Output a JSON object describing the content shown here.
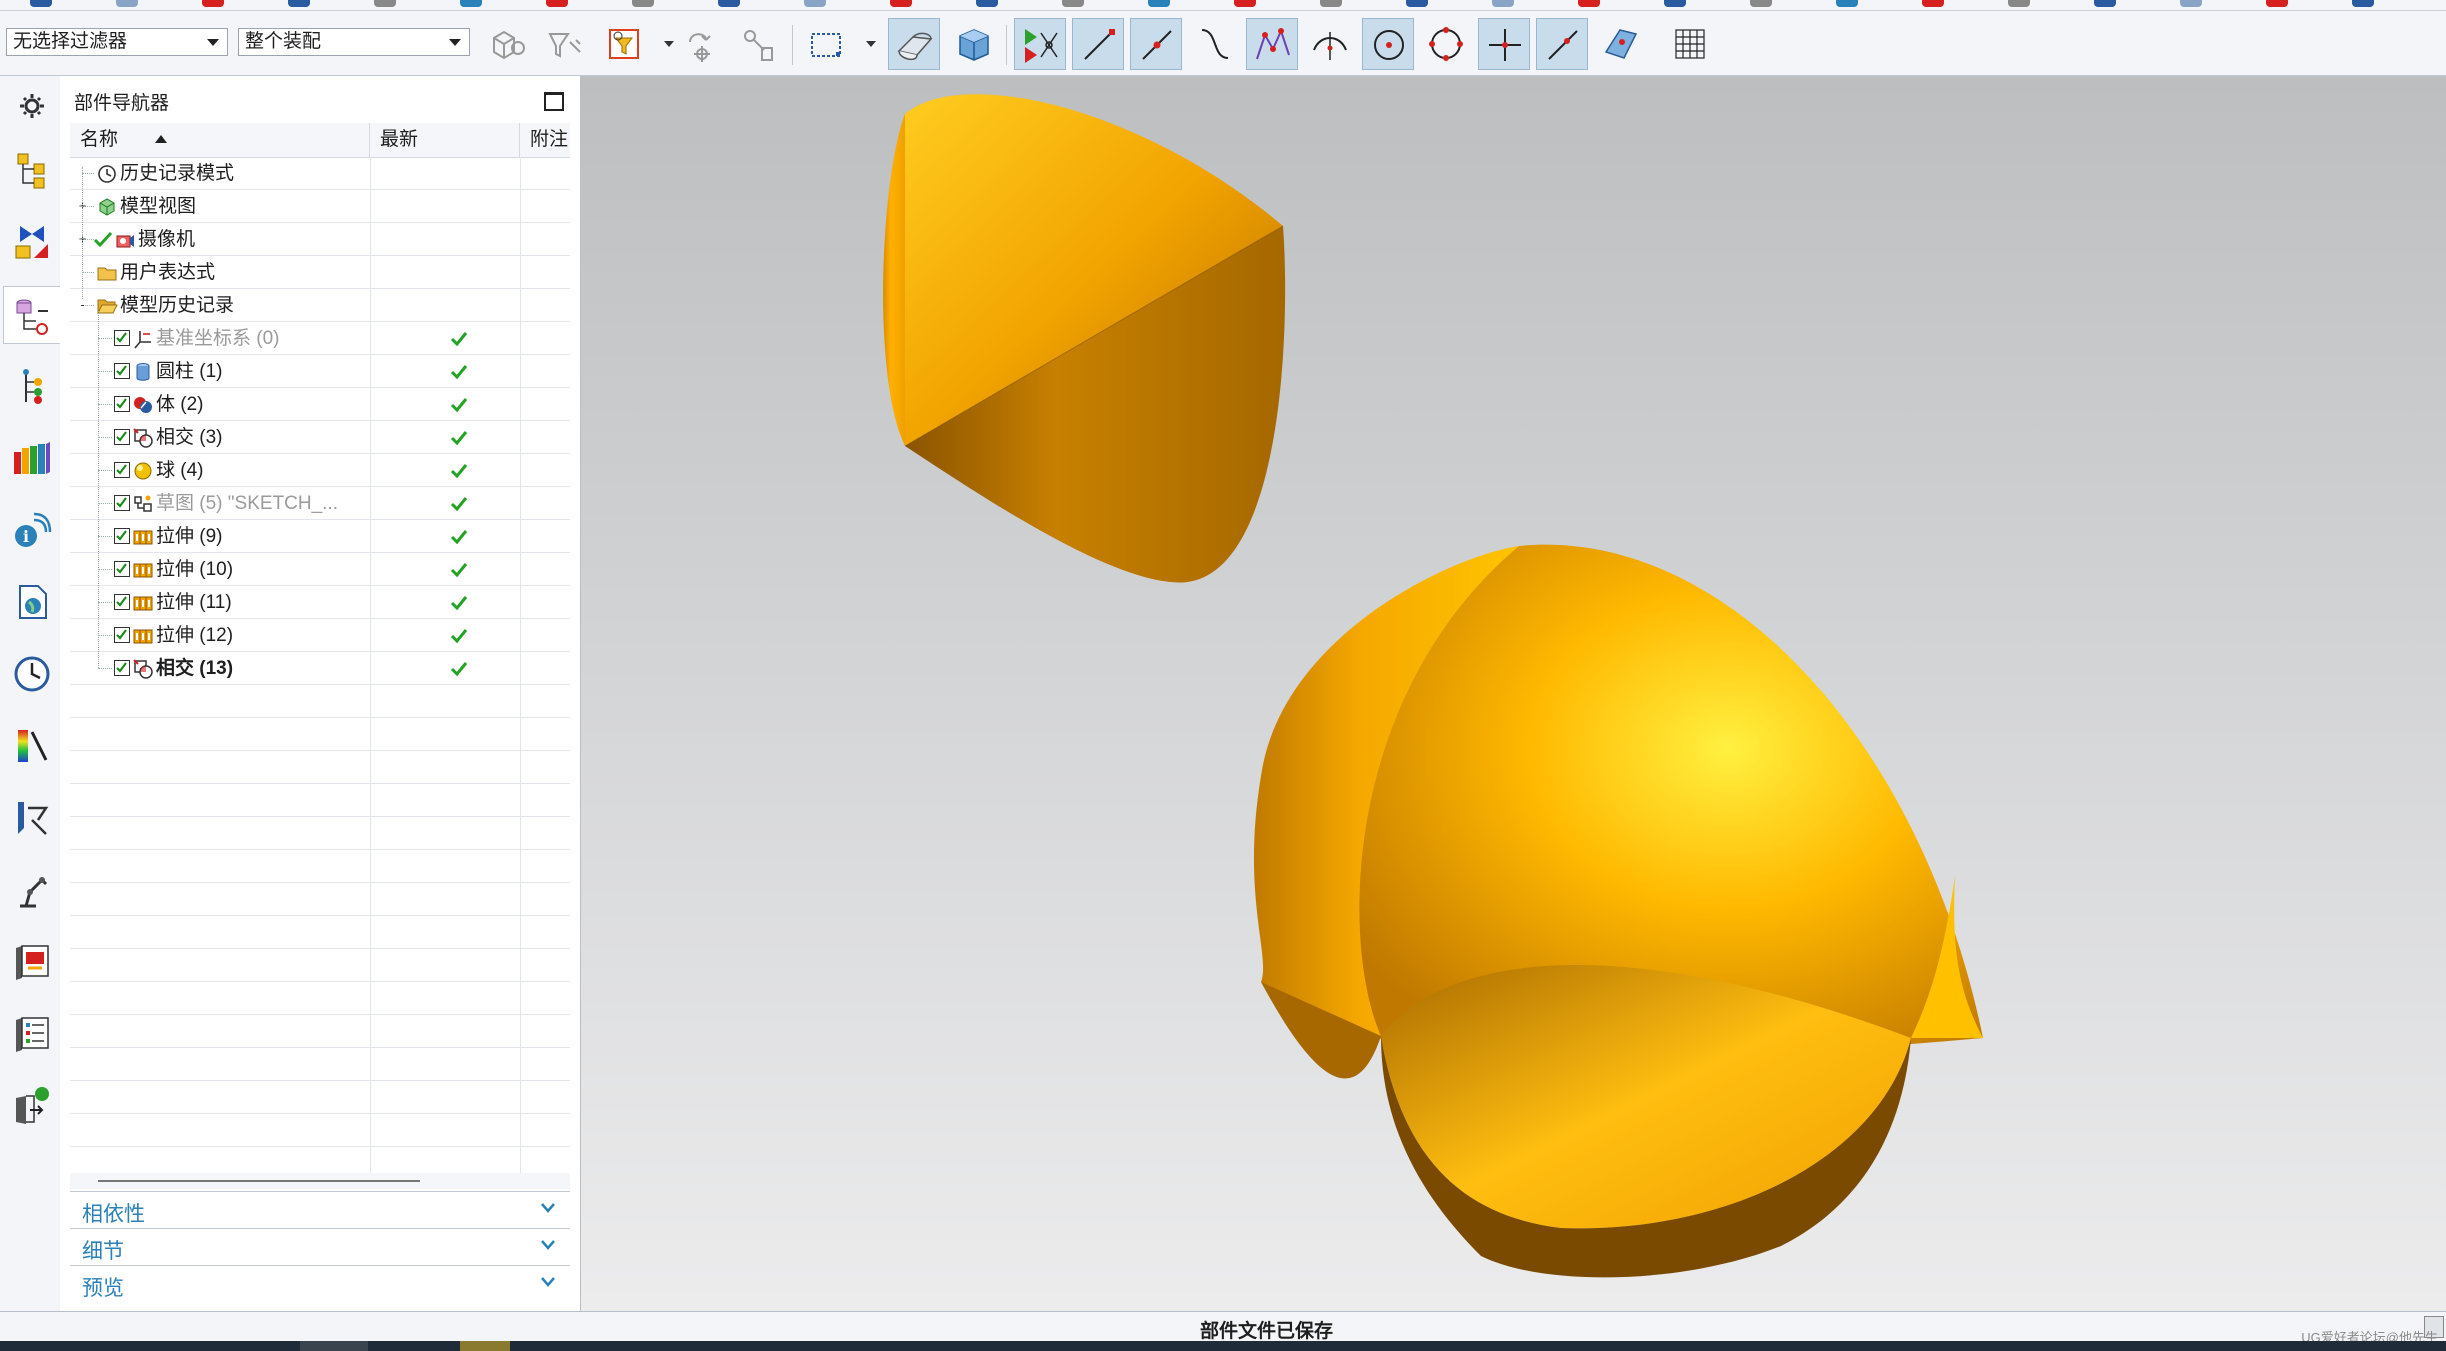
{
  "toolbar": {
    "filter_select": "无选择过滤器",
    "scope_select": "整个装配"
  },
  "navigator": {
    "title": "部件导航器",
    "columns": [
      "名称",
      "最新",
      "附注"
    ],
    "rows": [
      {
        "label": "历史记录模式",
        "icon": "clock-icon",
        "check": false,
        "latest": false,
        "style": "normal",
        "level": 0,
        "expander": ""
      },
      {
        "label": "模型视图",
        "icon": "model-view-icon",
        "check": false,
        "latest": false,
        "style": "normal",
        "level": 0,
        "expander": "+"
      },
      {
        "label": "摄像机",
        "icon": "camera-icon",
        "check": false,
        "latest": false,
        "style": "normal",
        "level": 0,
        "expander": "+"
      },
      {
        "label": "用户表达式",
        "icon": "folder-icon",
        "check": false,
        "latest": false,
        "style": "normal",
        "level": 0,
        "expander": ""
      },
      {
        "label": "模型历史记录",
        "icon": "folder-open-icon",
        "check": false,
        "latest": false,
        "style": "normal",
        "level": 0,
        "expander": "-"
      },
      {
        "label": "基准坐标系 (0)",
        "icon": "datum-csys-icon",
        "check": true,
        "latest": true,
        "style": "dim",
        "level": 1,
        "expander": ""
      },
      {
        "label": "圆柱 (1)",
        "icon": "cylinder-icon",
        "check": true,
        "latest": true,
        "style": "normal",
        "level": 1,
        "expander": ""
      },
      {
        "label": "体 (2)",
        "icon": "body-icon",
        "check": true,
        "latest": true,
        "style": "normal",
        "level": 1,
        "expander": ""
      },
      {
        "label": "相交 (3)",
        "icon": "intersect-icon",
        "check": true,
        "latest": true,
        "style": "normal",
        "level": 1,
        "expander": ""
      },
      {
        "label": "球 (4)",
        "icon": "sphere-icon",
        "check": true,
        "latest": true,
        "style": "normal",
        "level": 1,
        "expander": ""
      },
      {
        "label": "草图 (5) \"SKETCH_...",
        "icon": "sketch-icon",
        "check": true,
        "latest": true,
        "style": "dim",
        "level": 1,
        "expander": ""
      },
      {
        "label": "拉伸 (9)",
        "icon": "extrude-icon",
        "check": true,
        "latest": true,
        "style": "normal",
        "level": 1,
        "expander": ""
      },
      {
        "label": "拉伸 (10)",
        "icon": "extrude-icon",
        "check": true,
        "latest": true,
        "style": "normal",
        "level": 1,
        "expander": ""
      },
      {
        "label": "拉伸 (11)",
        "icon": "extrude-icon",
        "check": true,
        "latest": true,
        "style": "normal",
        "level": 1,
        "expander": ""
      },
      {
        "label": "拉伸 (12)",
        "icon": "extrude-icon",
        "check": true,
        "latest": true,
        "style": "normal",
        "level": 1,
        "expander": ""
      },
      {
        "label": "相交 (13)",
        "icon": "intersect-icon",
        "check": true,
        "latest": true,
        "style": "bold",
        "level": 1,
        "expander": ""
      }
    ],
    "sections": [
      "相依性",
      "细节",
      "预览"
    ]
  },
  "status": {
    "message": "部件文件已保存",
    "watermark": "UG爱好者论坛@他先生"
  },
  "colors": {
    "accent": "#2a80b9",
    "check_green": "#22a323",
    "model_gold": "#f2a400"
  }
}
